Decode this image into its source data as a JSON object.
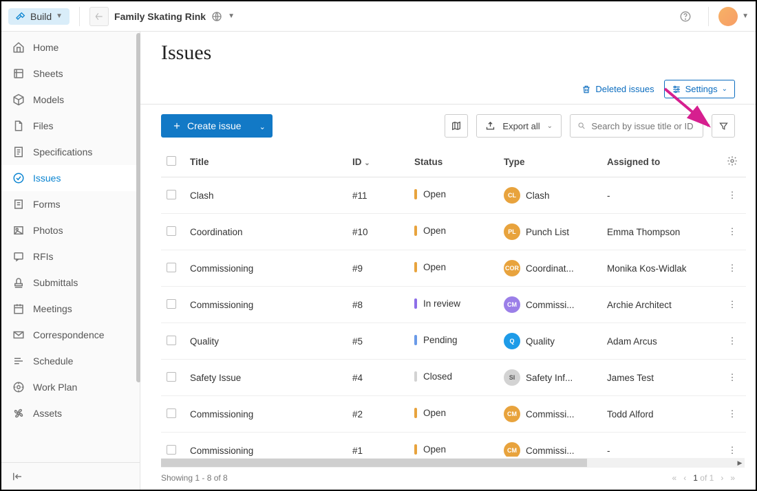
{
  "topbar": {
    "module": "Build",
    "project": "Family Skating Rink"
  },
  "sidebar": {
    "items": [
      {
        "label": "Home",
        "icon": "home"
      },
      {
        "label": "Sheets",
        "icon": "sheets"
      },
      {
        "label": "Models",
        "icon": "cube"
      },
      {
        "label": "Files",
        "icon": "file"
      },
      {
        "label": "Specifications",
        "icon": "spec"
      },
      {
        "label": "Issues",
        "icon": "check-circle",
        "active": true
      },
      {
        "label": "Forms",
        "icon": "form"
      },
      {
        "label": "Photos",
        "icon": "photo"
      },
      {
        "label": "RFIs",
        "icon": "rfi"
      },
      {
        "label": "Submittals",
        "icon": "stamp"
      },
      {
        "label": "Meetings",
        "icon": "calendar"
      },
      {
        "label": "Correspondence",
        "icon": "mail"
      },
      {
        "label": "Schedule",
        "icon": "schedule"
      },
      {
        "label": "Work Plan",
        "icon": "workplan"
      },
      {
        "label": "Assets",
        "icon": "fan"
      }
    ]
  },
  "page": {
    "title": "Issues"
  },
  "actions": {
    "deleted": "Deleted issues",
    "settings": "Settings",
    "create": "Create issue",
    "export": "Export all",
    "search_placeholder": "Search by issue title or ID"
  },
  "columns": {
    "title": "Title",
    "id": "ID",
    "status": "Status",
    "type": "Type",
    "assigned": "Assigned to"
  },
  "rows": [
    {
      "title": "Clash",
      "id": "#11",
      "status": "Open",
      "scolor": "#e8a33d",
      "badge": "CL",
      "bcolor": "#e8a33d",
      "type": "Clash",
      "assigned": "-"
    },
    {
      "title": "Coordination",
      "id": "#10",
      "status": "Open",
      "scolor": "#e8a33d",
      "badge": "PL",
      "bcolor": "#e8a33d",
      "type": "Punch List",
      "assigned": "Emma Thompson"
    },
    {
      "title": "Commissioning",
      "id": "#9",
      "status": "Open",
      "scolor": "#e8a33d",
      "badge": "COR",
      "bcolor": "#e8a33d",
      "type": "Coordinat...",
      "assigned": "Monika Kos-Widlak"
    },
    {
      "title": "Commissioning",
      "id": "#8",
      "status": "In review",
      "scolor": "#8d6ee8",
      "badge": "CM",
      "bcolor": "#9b7fe8",
      "type": "Commissi...",
      "assigned": "Archie Architect"
    },
    {
      "title": "Quality",
      "id": "#5",
      "status": "Pending",
      "scolor": "#6a9ae8",
      "badge": "Q",
      "bcolor": "#1e9be8",
      "type": "Quality",
      "assigned": "Adam Arcus"
    },
    {
      "title": "Safety Issue",
      "id": "#4",
      "status": "Closed",
      "scolor": "#d3d3d3",
      "badge": "SI",
      "bcolor": "#d3d3d3",
      "type": "Safety Inf...",
      "assigned": "James Test"
    },
    {
      "title": "Commissioning",
      "id": "#2",
      "status": "Open",
      "scolor": "#e8a33d",
      "badge": "CM",
      "bcolor": "#e8a33d",
      "type": "Commissi...",
      "assigned": "Todd Alford"
    },
    {
      "title": "Commissioning",
      "id": "#1",
      "status": "Open",
      "scolor": "#e8a33d",
      "badge": "CM",
      "bcolor": "#e8a33d",
      "type": "Commissi...",
      "assigned": "-"
    }
  ],
  "footer": {
    "showing": "Showing 1 - 8 of 8",
    "page_current": "1",
    "page_of": "of",
    "page_total": "1"
  }
}
